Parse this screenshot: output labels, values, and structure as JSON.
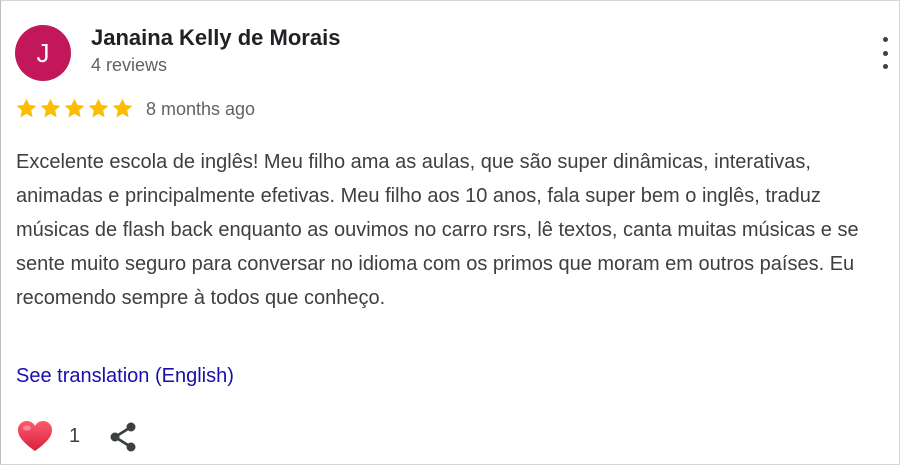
{
  "review": {
    "author_initial": "J",
    "author_name": "Janaina Kelly de Morais",
    "review_count": "4 reviews",
    "rating": 5,
    "rating_max": 5,
    "time_ago": "8 months ago",
    "text": "Excelente escola de inglês! Meu filho ama as aulas, que são super dinâmicas, interativas, animadas e principalmente efetivas. Meu filho aos 10 anos, fala super bem o inglês, traduz músicas de flash back enquanto as ouvimos no carro rsrs, lê textos, canta muitas músicas e se sente muito seguro para conversar no idioma com os primos que moram em outros países. Eu recomendo sempre à todos que conheço.",
    "translate_link": "See translation (English)",
    "like_count": "1"
  },
  "icons": {
    "more": "more-vert-icon",
    "star": "star-icon",
    "like": "heart-icon",
    "share": "share-icon"
  },
  "colors": {
    "avatar_bg": "#c2185b",
    "star": "#fbbc04",
    "link": "#1a0dab",
    "heart": "#e8384f"
  }
}
